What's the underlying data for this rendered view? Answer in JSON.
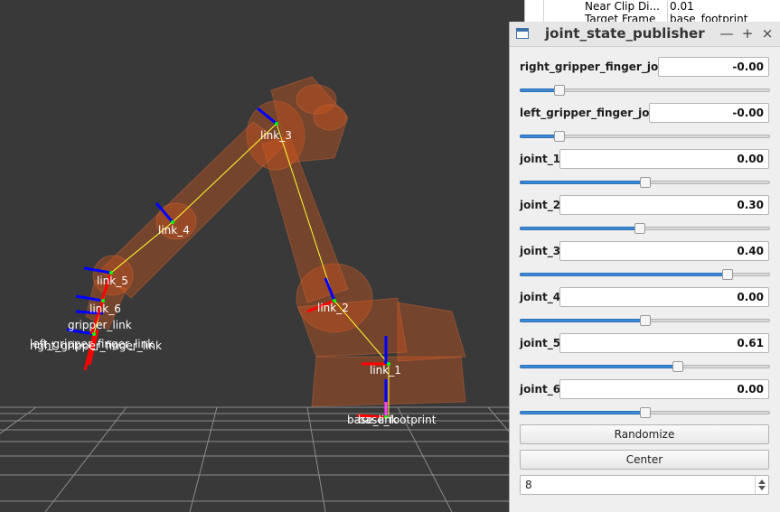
{
  "viewport": {
    "frames": {
      "link_3": "link_3",
      "link_4": "link_4",
      "link_5": "link_5",
      "link_6": "link_6",
      "gripper_link": "gripper_link",
      "right_gripper_finger_link": "right_gripper_finger_link",
      "left_gripper_finger_link": "left_gripper_finger_link",
      "link_2": "link_2",
      "link_1": "link_1",
      "base_link": "base_link",
      "base_footprint": "base_footprint"
    }
  },
  "properties": {
    "rows": [
      {
        "key": "Near Clip Di...",
        "value": "0.01"
      },
      {
        "key": "Target Frame",
        "value": "base_footprint"
      }
    ]
  },
  "window": {
    "title": "joint_state_publisher",
    "minimize_glyph": "—",
    "maximize_glyph": "+",
    "close_glyph": "×"
  },
  "joints": [
    {
      "name": "right_gripper_finger_joint",
      "value": "-0.00",
      "slider_fraction": 0.16
    },
    {
      "name": "left_gripper_finger_joint",
      "value": "-0.00",
      "slider_fraction": 0.16
    },
    {
      "name": "joint_1",
      "value": "0.00",
      "slider_fraction": 0.5
    },
    {
      "name": "joint_2",
      "value": "0.30",
      "slider_fraction": 0.48
    },
    {
      "name": "joint_3",
      "value": "0.40",
      "slider_fraction": 0.83
    },
    {
      "name": "joint_4",
      "value": "0.00",
      "slider_fraction": 0.5
    },
    {
      "name": "joint_5",
      "value": "0.61",
      "slider_fraction": 0.63
    },
    {
      "name": "joint_6",
      "value": "0.00",
      "slider_fraction": 0.5
    }
  ],
  "buttons": {
    "randomize": "Randomize",
    "center": "Center"
  },
  "spinbox": {
    "value": "8"
  },
  "colors": {
    "accent": "#3d8ad6",
    "robot": "#c8541c",
    "axis_x": "#ff0000",
    "axis_z": "#0000ff",
    "tf_line": "#ffff33"
  }
}
